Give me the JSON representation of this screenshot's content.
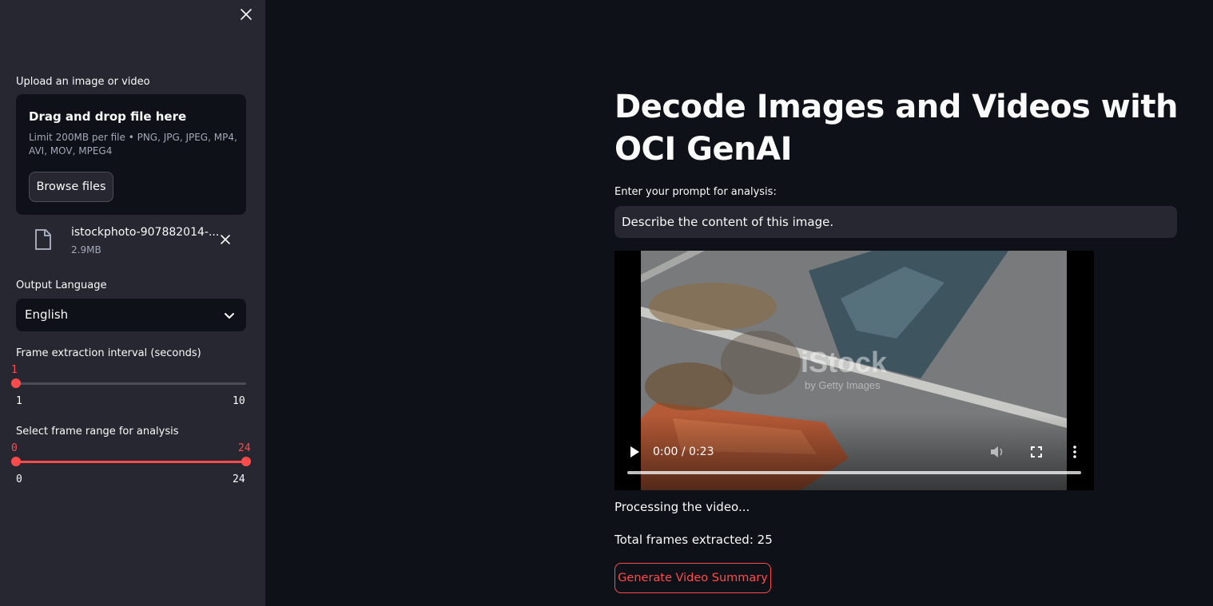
{
  "sidebar": {
    "upload_label": "Upload an image or video",
    "dropzone": {
      "title": "Drag and drop file here",
      "limit": "Limit 200MB per file • PNG, JPG, JPEG, MP4, AVI, MOV, MPEG4",
      "browse_label": "Browse files"
    },
    "uploaded_file": {
      "name": "istockphoto-907882014-...",
      "size": "2.9MB"
    },
    "language": {
      "label": "Output Language",
      "value": "English"
    },
    "interval_slider": {
      "label": "Frame extraction interval (seconds)",
      "value": 1,
      "min": 1,
      "max": 10,
      "value_label": "1",
      "min_label": "1",
      "max_label": "10"
    },
    "range_slider": {
      "label": "Select frame range for analysis",
      "low": 0,
      "high": 24,
      "min": 0,
      "max": 24,
      "low_label": "0",
      "high_label": "24",
      "min_label": "0",
      "max_label": "24"
    }
  },
  "main": {
    "title": "Decode Images and Videos with OCI GenAI",
    "prompt_label": "Enter your prompt for analysis:",
    "prompt_value": "Describe the content of this image.",
    "video": {
      "time": "0:00 / 0:23",
      "watermark": "iStock",
      "watermark_sub": "by Getty Images"
    },
    "processing_text": "Processing the video...",
    "frames_text": "Total frames extracted: 25",
    "generate_label": "Generate Video Summary"
  },
  "colors": {
    "accent": "#ff4b4b",
    "sidebar_bg": "#262730",
    "main_bg": "#0e1117"
  }
}
